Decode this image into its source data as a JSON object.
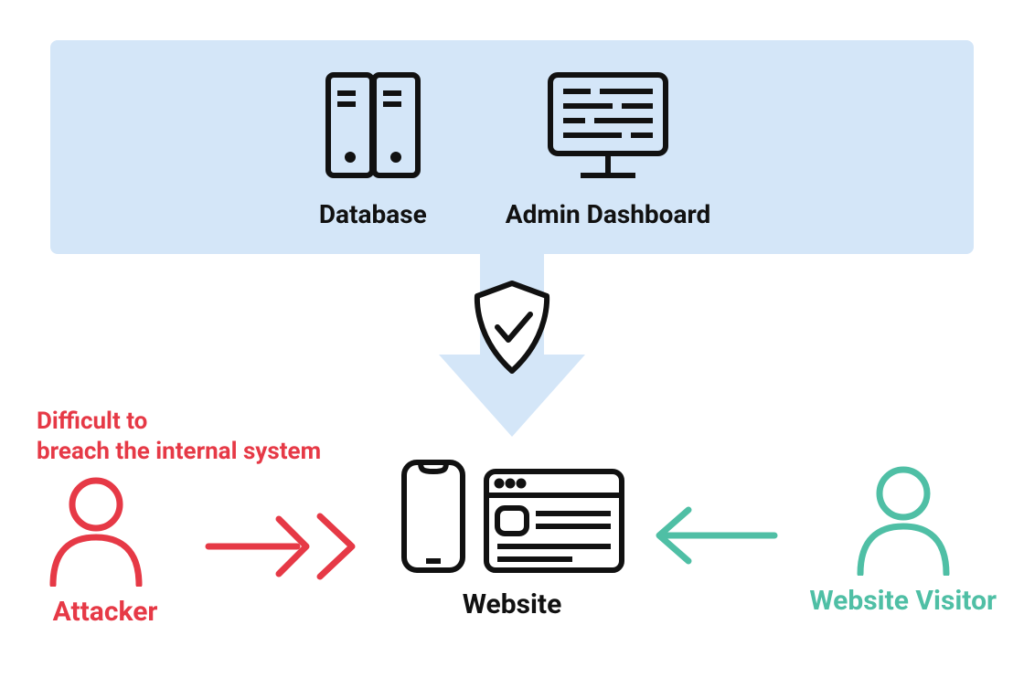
{
  "backend": {
    "database_label": "Database",
    "admin_label": "Admin Dashboard"
  },
  "attacker": {
    "note_line1": "Difficult to",
    "note_line2": "breach the internal system",
    "label": "Attacker"
  },
  "website": {
    "label": "Website"
  },
  "visitor": {
    "label": "Website Visitor"
  },
  "colors": {
    "red": "#e63946",
    "teal": "#4fbfa5",
    "blue_bg": "#d4e6f8",
    "black": "#111"
  }
}
